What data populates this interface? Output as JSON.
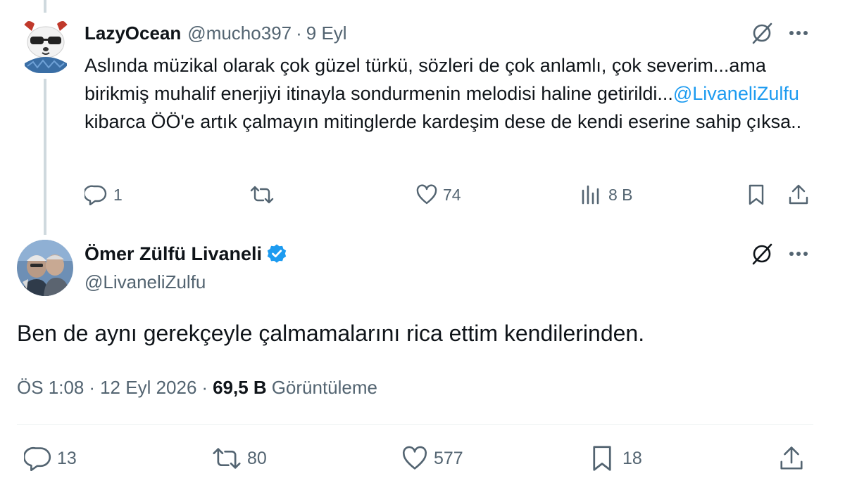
{
  "reply": {
    "author_name": "LazyOcean",
    "author_handle": "@mucho397",
    "separator": "·",
    "date": "9 Eyl",
    "text_before_mention": "Aslında müzikal olarak çok güzel türkü, sözleri de çok anlamlı, çok severim...ama birikmiş muhalif enerjiyi itinayla sondurmenin melodisi haline getirildi...",
    "mention": "@LivaneliZulfu",
    "text_after_mention": " kibarca ÖÖ'e artık çalmayın mitinglerde kardeşim dese de kendi eserine sahip çıksa..",
    "actions": {
      "replies": "1",
      "retweets": "",
      "likes": "74",
      "views": "8 B"
    }
  },
  "main_tweet": {
    "author_name": "Ömer Zülfü Livaneli",
    "author_handle": "@LivaneliZulfu",
    "text": "Ben de aynı gerekçeyle çalmamalarını rica ettim kendilerinden.",
    "time": "ÖS 1:08",
    "separator": "·",
    "date": "12 Eyl 2026",
    "views_count": "69,5 B",
    "views_label": "Görüntüleme",
    "actions": {
      "replies": "13",
      "retweets": "80",
      "likes": "577",
      "bookmarks": "18"
    }
  },
  "icons": {
    "grok": "grok-icon",
    "more": "more-icon",
    "reply": "reply-icon",
    "retweet": "retweet-icon",
    "like": "heart-icon",
    "views": "analytics-icon",
    "bookmark": "bookmark-icon",
    "share": "share-icon",
    "verified": "verified-badge-icon"
  },
  "colors": {
    "text": "#0f1419",
    "muted": "#536471",
    "link": "#1d9bf0",
    "verified": "#1d9bf0",
    "thread_line": "#cfd9de",
    "divider": "#eff3f4"
  }
}
